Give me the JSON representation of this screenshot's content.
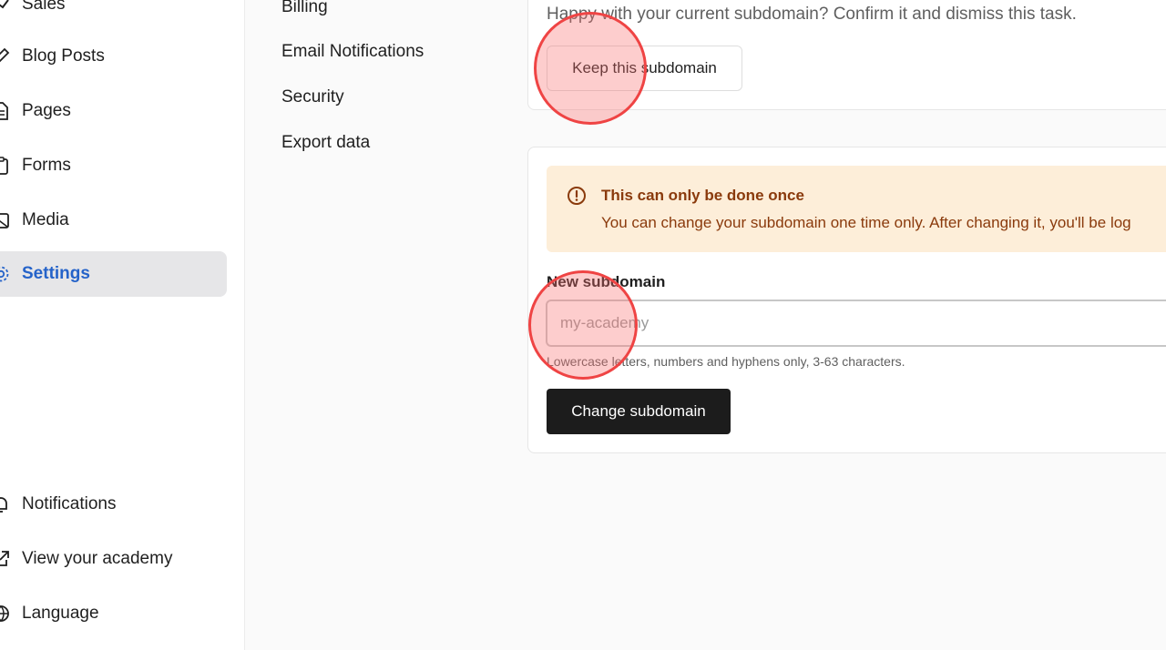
{
  "sidebar": {
    "items": [
      {
        "label": "Sales",
        "icon": "sales-icon"
      },
      {
        "label": "Blog Posts",
        "icon": "edit-icon"
      },
      {
        "label": "Pages",
        "icon": "page-icon"
      },
      {
        "label": "Forms",
        "icon": "clipboard-icon"
      },
      {
        "label": "Media",
        "icon": "image-icon"
      },
      {
        "label": "Settings",
        "icon": "gear-icon",
        "active": true
      },
      {
        "label": "Notifications",
        "icon": "bell-icon"
      },
      {
        "label": "View your academy",
        "icon": "external-link-icon"
      },
      {
        "label": "Language",
        "icon": "globe-icon"
      }
    ],
    "active_color": "#2563c9"
  },
  "settings_menu": {
    "items": [
      "Billing",
      "Email Notifications",
      "Security",
      "Export data"
    ]
  },
  "keep_card": {
    "text": "Happy with your current subdomain? Confirm it and dismiss this task.",
    "keep_button": "Keep this subdomain"
  },
  "change_card": {
    "warning_title": "This can only be done once",
    "warning_text": "You can change your subdomain one time only. After changing it, you'll be log",
    "field_label": "New subdomain",
    "input_placeholder": "my-academy",
    "input_value": "",
    "helper_text": "Lowercase letters, numbers and hyphens only, 3-63 characters.",
    "change_button": "Change subdomain"
  },
  "colors": {
    "warning_bg": "#fdeed9",
    "warning_text": "#8a3a0c",
    "primary_button": "#1c1c1c",
    "click_marker": "#ef4444"
  }
}
